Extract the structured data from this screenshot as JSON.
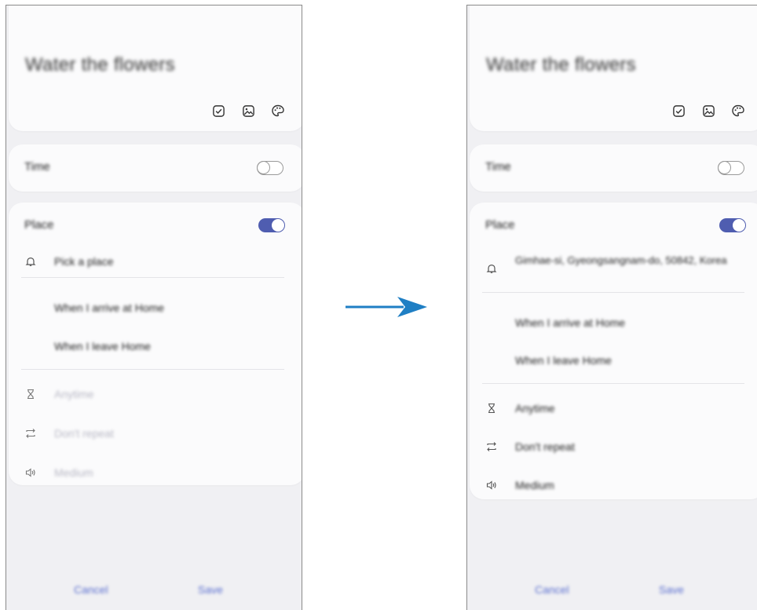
{
  "colors": {
    "accent": "#4f5db0",
    "arrow": "#1f7fc4",
    "link": "#5b6fcf",
    "background": "#f0f0f3",
    "card": "#fbfbfc"
  },
  "before": {
    "title": "Water the flowers",
    "title_icons": [
      "checkbox-icon",
      "image-icon",
      "palette-icon"
    ],
    "time": {
      "label": "Time",
      "enabled": false
    },
    "place": {
      "label": "Place",
      "enabled": true,
      "location": "Pick a place",
      "options": [
        "When I arrive at Home",
        "When I leave Home"
      ],
      "details": [
        {
          "icon": "hourglass-icon",
          "label": "Anytime"
        },
        {
          "icon": "repeat-icon",
          "label": "Don't repeat"
        },
        {
          "icon": "volume-icon",
          "label": "Medium"
        }
      ]
    },
    "actions": {
      "cancel": "Cancel",
      "save": "Save"
    }
  },
  "after": {
    "title": "Water the flowers",
    "title_icons": [
      "checkbox-icon",
      "image-icon",
      "palette-icon"
    ],
    "time": {
      "label": "Time",
      "enabled": false
    },
    "place": {
      "label": "Place",
      "enabled": true,
      "location": "Gimhae-si, Gyeongsangnam-do, 50842, Korea",
      "options": [
        "When I arrive at Home",
        "When I leave Home"
      ],
      "details": [
        {
          "icon": "hourglass-icon",
          "label": "Anytime"
        },
        {
          "icon": "repeat-icon",
          "label": "Don't repeat"
        },
        {
          "icon": "volume-icon",
          "label": "Medium"
        }
      ]
    },
    "actions": {
      "cancel": "Cancel",
      "save": "Save"
    }
  }
}
